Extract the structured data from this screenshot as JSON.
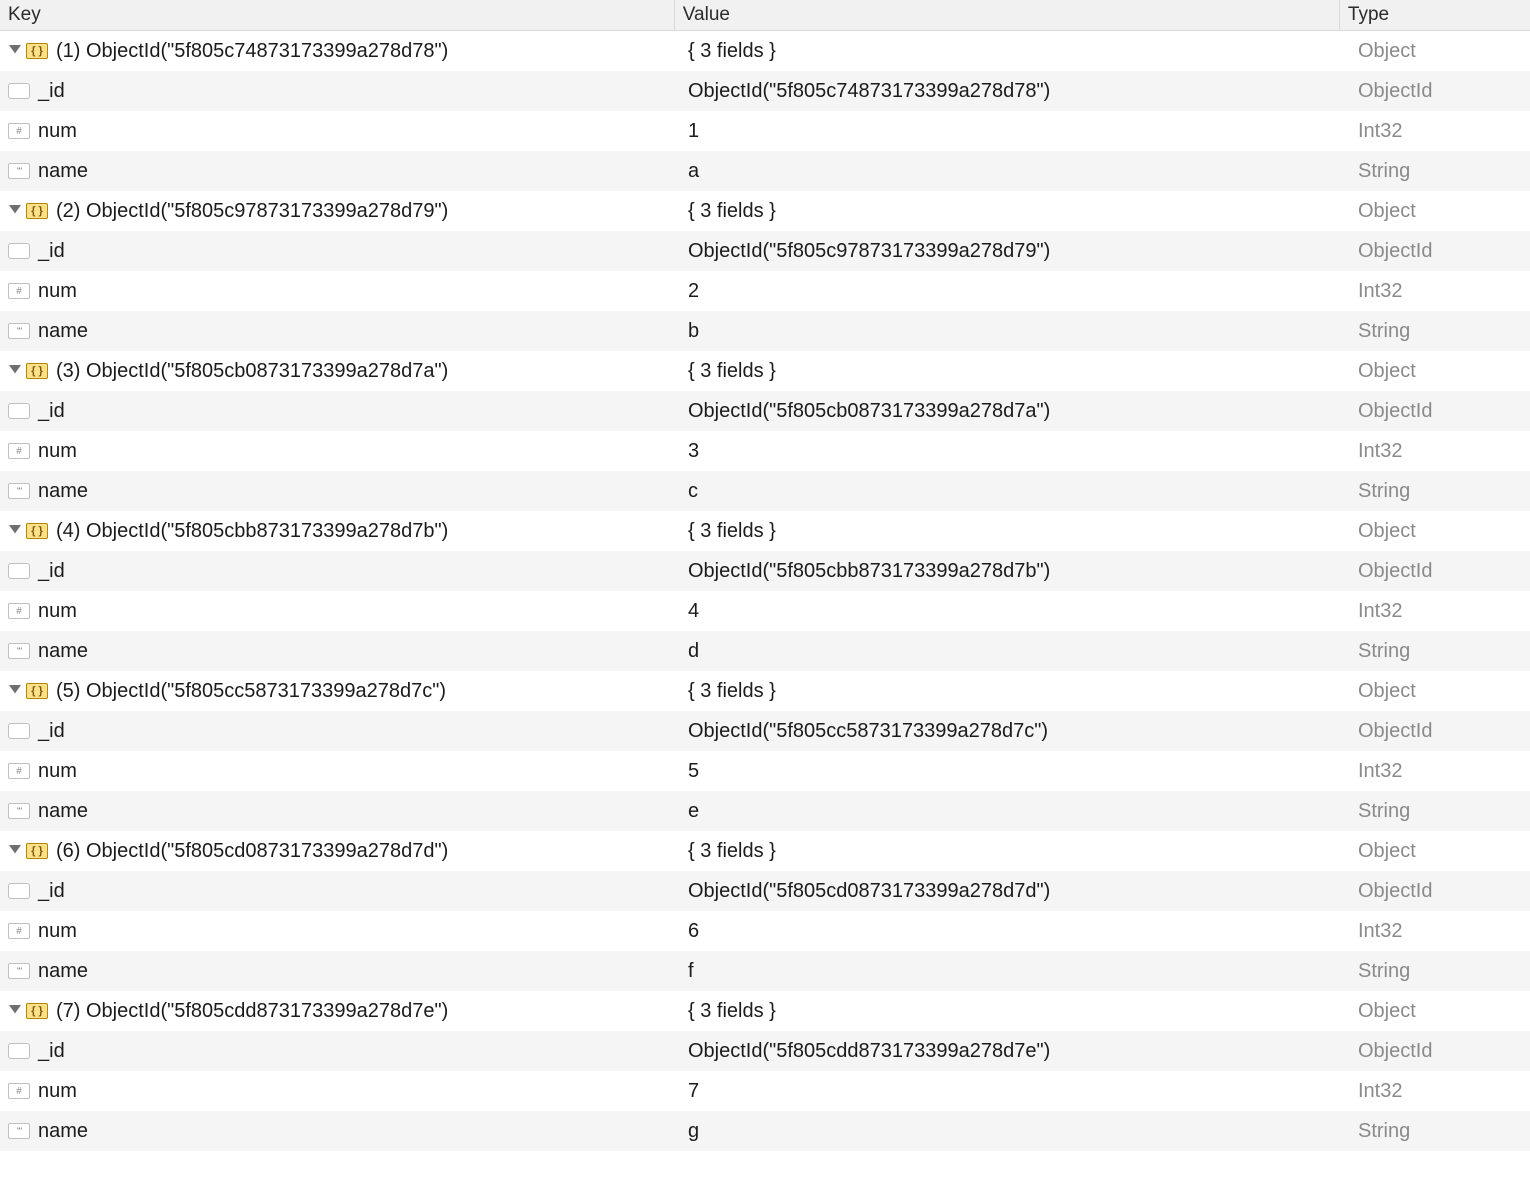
{
  "columns": {
    "key": "Key",
    "value": "Value",
    "type": "Type"
  },
  "types": {
    "object": "Object",
    "objectid": "ObjectId",
    "int32": "Int32",
    "string": "String"
  },
  "summary_template": "{ 3 fields }",
  "documents": [
    {
      "index": "(1)",
      "label": "ObjectId(\"5f805c74873173399a278d78\")",
      "fields": [
        {
          "key": "_id",
          "value": "ObjectId(\"5f805c74873173399a278d78\")",
          "type": "objectid",
          "icon": "obj"
        },
        {
          "key": "num",
          "value": "1",
          "type": "int32",
          "icon": "int"
        },
        {
          "key": "name",
          "value": "a",
          "type": "string",
          "icon": "str"
        }
      ]
    },
    {
      "index": "(2)",
      "label": "ObjectId(\"5f805c97873173399a278d79\")",
      "fields": [
        {
          "key": "_id",
          "value": "ObjectId(\"5f805c97873173399a278d79\")",
          "type": "objectid",
          "icon": "obj"
        },
        {
          "key": "num",
          "value": "2",
          "type": "int32",
          "icon": "int"
        },
        {
          "key": "name",
          "value": "b",
          "type": "string",
          "icon": "str"
        }
      ]
    },
    {
      "index": "(3)",
      "label": "ObjectId(\"5f805cb0873173399a278d7a\")",
      "fields": [
        {
          "key": "_id",
          "value": "ObjectId(\"5f805cb0873173399a278d7a\")",
          "type": "objectid",
          "icon": "obj"
        },
        {
          "key": "num",
          "value": "3",
          "type": "int32",
          "icon": "int"
        },
        {
          "key": "name",
          "value": "c",
          "type": "string",
          "icon": "str"
        }
      ]
    },
    {
      "index": "(4)",
      "label": "ObjectId(\"5f805cbb873173399a278d7b\")",
      "fields": [
        {
          "key": "_id",
          "value": "ObjectId(\"5f805cbb873173399a278d7b\")",
          "type": "objectid",
          "icon": "obj"
        },
        {
          "key": "num",
          "value": "4",
          "type": "int32",
          "icon": "int"
        },
        {
          "key": "name",
          "value": "d",
          "type": "string",
          "icon": "str"
        }
      ]
    },
    {
      "index": "(5)",
      "label": "ObjectId(\"5f805cc5873173399a278d7c\")",
      "fields": [
        {
          "key": "_id",
          "value": "ObjectId(\"5f805cc5873173399a278d7c\")",
          "type": "objectid",
          "icon": "obj"
        },
        {
          "key": "num",
          "value": "5",
          "type": "int32",
          "icon": "int"
        },
        {
          "key": "name",
          "value": "e",
          "type": "string",
          "icon": "str"
        }
      ]
    },
    {
      "index": "(6)",
      "label": "ObjectId(\"5f805cd0873173399a278d7d\")",
      "fields": [
        {
          "key": "_id",
          "value": "ObjectId(\"5f805cd0873173399a278d7d\")",
          "type": "objectid",
          "icon": "obj"
        },
        {
          "key": "num",
          "value": "6",
          "type": "int32",
          "icon": "int"
        },
        {
          "key": "name",
          "value": "f",
          "type": "string",
          "icon": "str"
        }
      ]
    },
    {
      "index": "(7)",
      "label": "ObjectId(\"5f805cdd873173399a278d7e\")",
      "fields": [
        {
          "key": "_id",
          "value": "ObjectId(\"5f805cdd873173399a278d7e\")",
          "type": "objectid",
          "icon": "obj"
        },
        {
          "key": "num",
          "value": "7",
          "type": "int32",
          "icon": "int"
        },
        {
          "key": "name",
          "value": "g",
          "type": "string",
          "icon": "str"
        }
      ]
    }
  ]
}
